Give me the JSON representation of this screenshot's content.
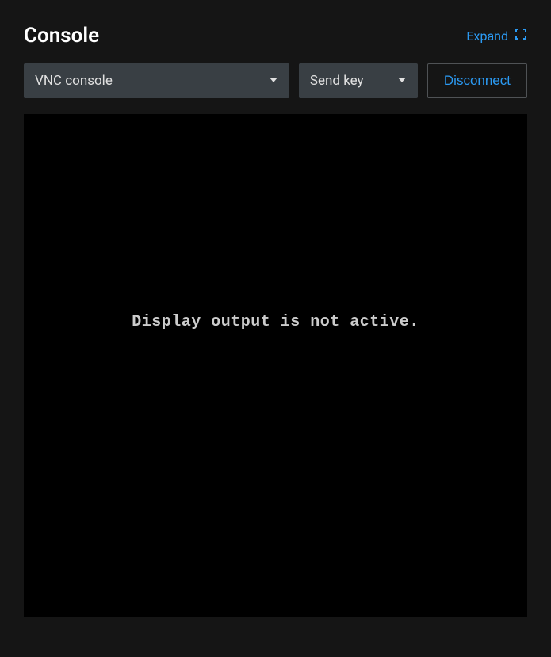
{
  "header": {
    "title": "Console",
    "expand_label": "Expand"
  },
  "controls": {
    "console_type_selected": "VNC console",
    "send_key_label": "Send key",
    "disconnect_label": "Disconnect"
  },
  "viewport": {
    "message": "Display output is not active."
  }
}
